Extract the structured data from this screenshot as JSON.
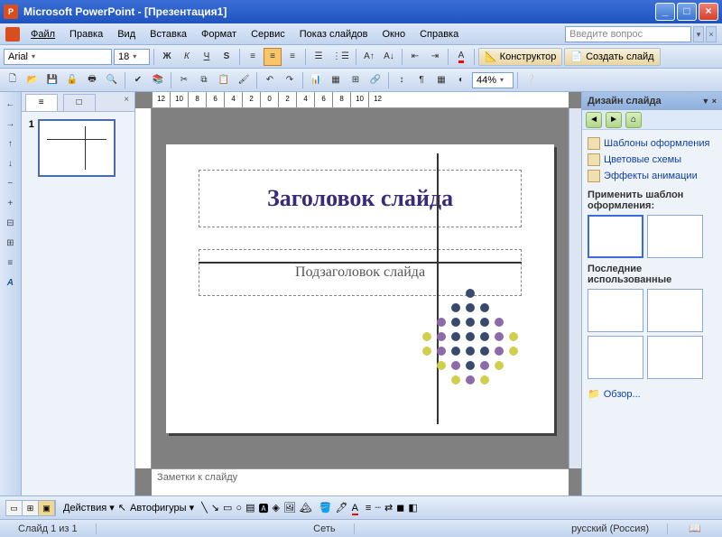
{
  "title": "Microsoft PowerPoint - [Презентация1]",
  "menu": [
    "Файл",
    "Правка",
    "Вид",
    "Вставка",
    "Формат",
    "Сервис",
    "Показ слайдов",
    "Окно",
    "Справка"
  ],
  "ask_placeholder": "Введите вопрос",
  "font": {
    "name": "Arial",
    "size": "18"
  },
  "designer_btn": "Конструктор",
  "newslide_btn": "Создать слайд",
  "zoom": "44%",
  "thumb": {
    "num": "1"
  },
  "slide": {
    "title": "Заголовок слайда",
    "subtitle": "Подзаголовок слайда"
  },
  "notes": "Заметки к слайду",
  "taskpane": {
    "title": "Дизайн слайда",
    "links": [
      "Шаблоны оформления",
      "Цветовые схемы",
      "Эффекты анимации"
    ],
    "section1": "Применить шаблон оформления:",
    "section2": "Последние использованные",
    "browse": "Обзор..."
  },
  "draw": {
    "actions": "Действия",
    "autoshapes": "Автофигуры"
  },
  "status": {
    "slide": "Слайд 1 из 1",
    "layout": "Сеть",
    "lang": "русский (Россия)"
  }
}
